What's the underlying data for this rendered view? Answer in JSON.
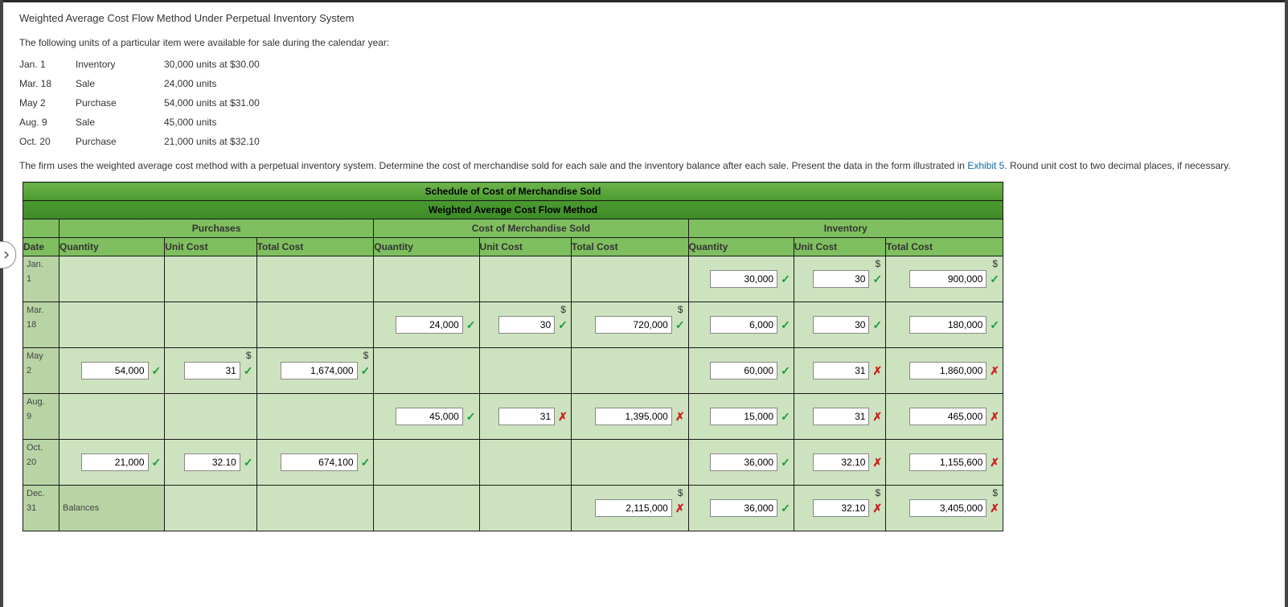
{
  "title": "Weighted Average Cost Flow Method Under Perpetual Inventory System",
  "intro": "The following units of a particular item were available for sale during the calendar year:",
  "given": [
    {
      "d": "Jan. 1",
      "t": "Inventory",
      "v": "30,000 units at $30.00"
    },
    {
      "d": "Mar. 18",
      "t": "Sale",
      "v": "24,000 units"
    },
    {
      "d": "May 2",
      "t": "Purchase",
      "v": "54,000 units at $31.00"
    },
    {
      "d": "Aug. 9",
      "t": "Sale",
      "v": "45,000 units"
    },
    {
      "d": "Oct. 20",
      "t": "Purchase",
      "v": "21,000 units at $32.10"
    }
  ],
  "instr_a": "The firm uses the weighted average cost method with a perpetual inventory system. Determine the cost of merchandise sold for each sale and the inventory balance after each sale. Present the data in the form illustrated in ",
  "instr_link": "Exhibit 5",
  "instr_b": ". Round unit cost to two decimal places, if necessary.",
  "table": {
    "top1": "Schedule of Cost of Merchandise Sold",
    "top2": "Weighted Average Cost Flow Method",
    "sec": [
      "Purchases",
      "Cost of Merchandise Sold",
      "Inventory"
    ],
    "cols": [
      "Date",
      "Quantity",
      "Unit Cost",
      "Total Cost",
      "Quantity",
      "Unit Cost",
      "Total Cost",
      "Quantity",
      "Unit Cost",
      "Total Cost"
    ],
    "bal": "Balances"
  },
  "rows": {
    "jan": {
      "date1": "Jan.",
      "date2": "1",
      "iq": {
        "v": "30,000",
        "ok": true
      },
      "iu": {
        "v": "30",
        "ok": true,
        "d": true
      },
      "it": {
        "v": "900,000",
        "ok": true,
        "d": true
      }
    },
    "mar": {
      "date1": "Mar.",
      "date2": "18",
      "cq": {
        "v": "24,000",
        "ok": true
      },
      "cu": {
        "v": "30",
        "ok": true,
        "d": true
      },
      "ct": {
        "v": "720,000",
        "ok": true,
        "d": true
      },
      "iq": {
        "v": "6,000",
        "ok": true
      },
      "iu": {
        "v": "30",
        "ok": true
      },
      "it": {
        "v": "180,000",
        "ok": true
      }
    },
    "may": {
      "date1": "May",
      "date2": "2",
      "pq": {
        "v": "54,000",
        "ok": true
      },
      "pu": {
        "v": "31",
        "ok": true,
        "d": true
      },
      "pt": {
        "v": "1,674,000",
        "ok": true,
        "d": true
      },
      "iq": {
        "v": "60,000",
        "ok": true
      },
      "iu": {
        "v": "31",
        "ok": false
      },
      "it": {
        "v": "1,860,000",
        "ok": false
      }
    },
    "aug": {
      "date1": "Aug.",
      "date2": "9",
      "cq": {
        "v": "45,000",
        "ok": true
      },
      "cu": {
        "v": "31",
        "ok": false
      },
      "ct": {
        "v": "1,395,000",
        "ok": false
      },
      "iq": {
        "v": "15,000",
        "ok": true
      },
      "iu": {
        "v": "31",
        "ok": false
      },
      "it": {
        "v": "465,000",
        "ok": false
      }
    },
    "oct": {
      "date1": "Oct.",
      "date2": "20",
      "pq": {
        "v": "21,000",
        "ok": true
      },
      "pu": {
        "v": "32.10",
        "ok": true
      },
      "pt": {
        "v": "674,100",
        "ok": true
      },
      "iq": {
        "v": "36,000",
        "ok": true
      },
      "iu": {
        "v": "32.10",
        "ok": false
      },
      "it": {
        "v": "1,155,600",
        "ok": false
      }
    },
    "dec": {
      "date1": "Dec.",
      "date2": "31",
      "ct": {
        "v": "2,115,000",
        "ok": false,
        "d": true
      },
      "iq": {
        "v": "36,000",
        "ok": true
      },
      "iu": {
        "v": "32.10",
        "ok": false,
        "d": true
      },
      "it": {
        "v": "3,405,000",
        "ok": false,
        "d": true
      }
    }
  },
  "glyph": {
    "ok": "✓",
    "bad": "✗"
  }
}
